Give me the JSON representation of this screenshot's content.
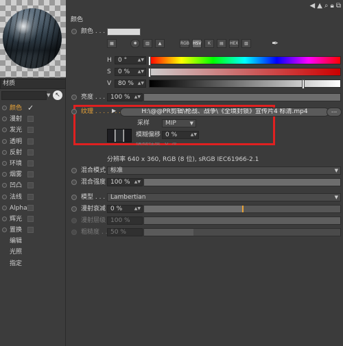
{
  "window": {
    "top_icons": [
      "arrow-left-icon",
      "arrow-up-icon",
      "search-icon",
      "lock-icon",
      "duplicate-icon"
    ]
  },
  "left": {
    "material_name_label": "材质",
    "channels": [
      {
        "label": "颜色",
        "active": true,
        "checked": true
      },
      {
        "label": "漫射",
        "active": false,
        "checked": false
      },
      {
        "label": "发光",
        "active": false,
        "checked": false
      },
      {
        "label": "透明",
        "active": false,
        "checked": false
      },
      {
        "label": "反射",
        "active": false,
        "checked": false
      },
      {
        "label": "环境",
        "active": false,
        "checked": false
      },
      {
        "label": "烟雾",
        "active": false,
        "checked": false
      },
      {
        "label": "凹凸",
        "active": false,
        "checked": false
      },
      {
        "label": "法线",
        "active": false,
        "checked": false
      },
      {
        "label": "Alpha",
        "active": false,
        "checked": false
      },
      {
        "label": "辉光",
        "active": false,
        "checked": false
      },
      {
        "label": "置换",
        "active": false,
        "checked": false
      },
      {
        "label": "编辑",
        "plain": true
      },
      {
        "label": "光照",
        "plain": true
      },
      {
        "label": "指定",
        "plain": true
      }
    ]
  },
  "color": {
    "section_title": "颜色",
    "color_label": "颜色 . . . .",
    "mode_icons": [
      "picker-grid-icon",
      "color-wheel-icon",
      "spectrum-icon",
      "image-icon",
      "RGB",
      "HSV",
      "K",
      "mix-icon",
      "HEX",
      "swatches-icon"
    ],
    "h_label": "H",
    "h_value": "0 °",
    "s_label": "S",
    "s_value": "0 %",
    "v_label": "V",
    "v_value": "80 %",
    "v_level": 0.8,
    "brightness_label": "亮度 . . . . . .",
    "brightness_value": "100 %"
  },
  "texture": {
    "label": "纹理 . . . . . . .",
    "path": "H:\\@@PR剪辑\\枪战、战争\\《全境封锁》宣传片4 标清.mp4",
    "more": "...",
    "sampling_label": "采样",
    "sampling_value": "MIP",
    "blur_offset_label": "模糊偏移",
    "blur_offset_value": "0 %",
    "blur_scale_label": "模糊程度",
    "blur_scale_value": "0 %",
    "resolution_text": "分辨率 640 x 360, RGB (8 位), sRGB IEC61966-2.1"
  },
  "mix": {
    "mode_label": "混合模式",
    "mode_value": "标准",
    "strength_label": "混合强度",
    "strength_value": "100 %"
  },
  "model": {
    "model_label": "模型 . . . . . .",
    "model_value": "Lambertian",
    "diffuse_falloff_label": "漫射衰减",
    "diffuse_falloff_value": "0 %",
    "diffuse_level_label": "漫射层级",
    "diffuse_level_value": "100 %",
    "roughness_label": "粗糙度 . . . .",
    "roughness_value": "50 %"
  }
}
